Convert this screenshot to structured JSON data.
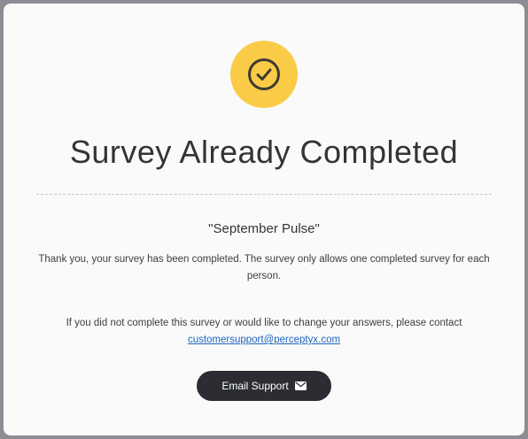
{
  "header": {
    "icon": "check-circle-icon",
    "badge_color": "#f9cb47",
    "title": "Survey Already Completed"
  },
  "survey": {
    "name": "\"September Pulse\""
  },
  "messages": {
    "completed": "Thank you, your survey has been completed. The survey only allows one completed survey for each person.",
    "contact_prefix": "If you did not complete this survey or would like to change your answers, please contact",
    "contact_email": "customersupport@perceptyx.com"
  },
  "actions": {
    "email_support_label": "Email Support",
    "email_support_icon": "envelope-icon"
  },
  "colors": {
    "background": "#fafafa",
    "button": "#2b2d33",
    "link": "#1f66c1"
  }
}
